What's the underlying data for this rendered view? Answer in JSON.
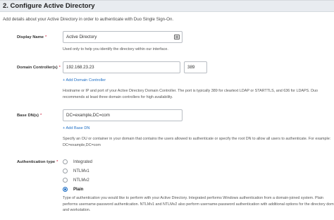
{
  "section": {
    "title": "2. Configure Active Directory",
    "intro": "Add details about your Active Directory in order to authenticate with Duo Single Sign-On."
  },
  "display_name": {
    "label": "Display Name",
    "required_marker": "*",
    "value": "Active Directory",
    "help": "Used only to help you identify the directory within our interface.",
    "autofill_icon": "contact-card-icon"
  },
  "domain_controllers": {
    "label": "Domain Controller(s)",
    "required_marker": "*",
    "host_value": "192.168.23.23",
    "port_value": "389",
    "add_link": "+ Add Domain Controller",
    "help_lines": [
      "Hostname or IP and port of your Active Directory Domain Controller. The port is typically 389 for cleartext LDAP or STARTTLS, and 636 for LDAPS. Duo",
      "recommends at least three domain controllers for high availability."
    ]
  },
  "base_dns": {
    "label": "Base DN(s)",
    "required_marker": "*",
    "value": "DC=example,DC=com",
    "add_link": "+ Add Base DN",
    "help_lines": [
      "Specify an OU or container in your domain that contains the users allowed to authenticate or specify the root DN to allow all users to authenticate. For example:",
      "DC=example,DC=com"
    ]
  },
  "authentication_type": {
    "label": "Authentication type",
    "required_marker": "*",
    "options": [
      {
        "label": "Integrated",
        "selected": false
      },
      {
        "label": "NTLMv1",
        "selected": false
      },
      {
        "label": "NTLMv2",
        "selected": false
      },
      {
        "label": "Plain",
        "selected": true
      }
    ],
    "help_lines": [
      "Type of authentication you would like to perform with your Active Directory. Integrated performs Windows authentication from a domain-joined system. Plain",
      "performs username-password authentication. NTLMv1 and NTLMv2 also perform username-password authentication with additional options for the directory domain",
      "and workstation."
    ]
  },
  "colors": {
    "header_bg": "#e8ecf0",
    "link": "#1f6fc5",
    "required": "#c8102e",
    "radio_selected": "#1f6fc5"
  }
}
